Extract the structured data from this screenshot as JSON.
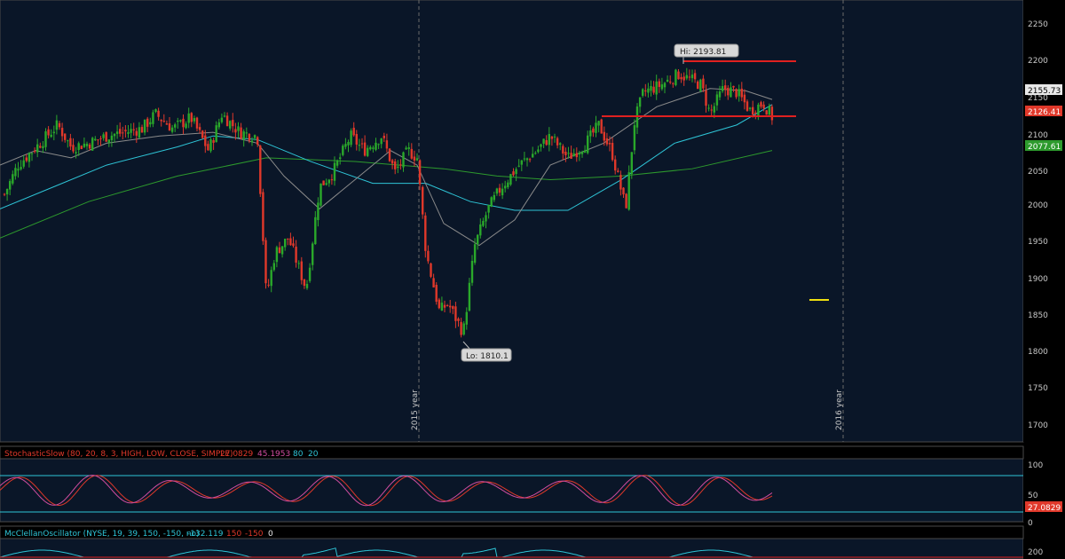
{
  "colors": {
    "background": "#000000",
    "plot_bg": "#0a1628",
    "border": "#5a5a5a",
    "up_candle": "#2aa82a",
    "down_candle": "#e0382a",
    "sma_fast": "#8a8a8a",
    "sma_mid": "#2ec4d6",
    "sma_slow": "#2d9a2d",
    "level_line": "#e02020",
    "marker": "#f0e010",
    "stoch_k": "#e0382a",
    "stoch_d": "#d04da0",
    "stoch_band": "#2ec4d6",
    "mcclellan_line": "#2ec4d6"
  },
  "main_chart": {
    "price_labels": [
      "2250",
      "2200",
      "2150",
      "2100",
      "2050",
      "2000",
      "1950",
      "1900",
      "1850",
      "1800",
      "1750",
      "1700"
    ],
    "year_labels": [
      "2015 year",
      "2016 year"
    ],
    "hi_label": "Hi: 2193.81",
    "lo_label": "Lo: 1810.1",
    "last_price_badges": [
      {
        "text": "2155.73",
        "color": "#e8e8e8",
        "text_color": "#000"
      },
      {
        "text": "2126.41",
        "color": "#e0382a",
        "text_color": "#fff"
      },
      {
        "text": "2077.61",
        "color": "#2d9a2d",
        "text_color": "#fff"
      }
    ],
    "horizontal_levels": [
      2193.81,
      2126.41
    ],
    "marker_level": 1870
  },
  "chart_data": {
    "type": "candlestick",
    "series": [
      {
        "name": "price",
        "ohlc_points": "generated"
      }
    ],
    "ylim": [
      1680,
      2260
    ],
    "hi": 2193.81,
    "lo": 1810.1
  },
  "stochastic": {
    "title": "StochasticSlow (80, 20, 8, 3, HIGH, LOW, CLOSE, SIMPLE)",
    "values": [
      "27.0829",
      "45.1953",
      "80",
      "20"
    ],
    "axis_labels": [
      "100",
      "50",
      "0"
    ],
    "last_badge": "27.0829"
  },
  "mcclellan": {
    "title": "McClellanOscillator (NYSE, 19, 39, 150, -150, no)",
    "values": [
      "-132.119",
      "150",
      "-150",
      "0"
    ],
    "axis_label": "200"
  }
}
